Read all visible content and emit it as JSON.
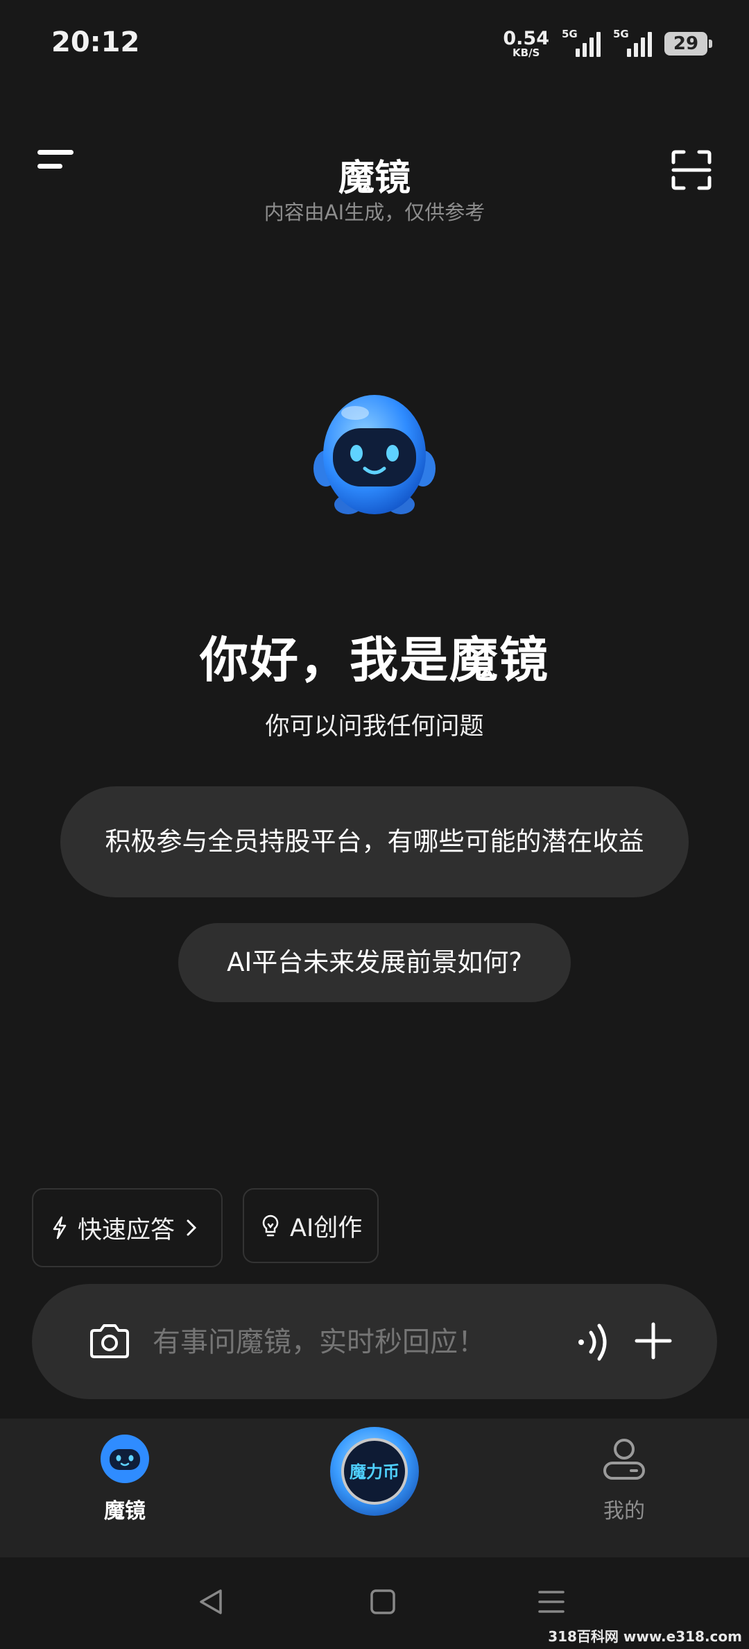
{
  "status_bar": {
    "time": "20:12",
    "net_speed_value": "0.54",
    "net_speed_unit": "KB/S",
    "signal1_label": "5G",
    "signal2_label": "5G",
    "battery": "29"
  },
  "header": {
    "title": "魔镜",
    "subtitle": "内容由AI生成，仅供参考",
    "menu_icon": "menu-icon",
    "scan_icon": "scan-icon"
  },
  "welcome": {
    "mascot_icon": "robot-mascot",
    "greeting": "你好，我是魔镜",
    "prompt": "你可以问我任何问题"
  },
  "suggestions": [
    {
      "text": "积极参与全员持股平台，有哪些可能的潜在收益"
    },
    {
      "text": "AI平台未来发展前景如何?"
    }
  ],
  "modes": {
    "quick": {
      "label": "快速应答",
      "icon": "lightning-icon"
    },
    "create": {
      "label": "AI创作",
      "icon": "lightbulb-icon"
    }
  },
  "input": {
    "placeholder": "有事问魔镜，实时秒回应！",
    "value": ""
  },
  "bottom_nav": {
    "items": [
      {
        "label": "魔镜",
        "icon": "robot-icon",
        "active": true
      },
      {
        "label": "魔力币",
        "icon": "coin-icon",
        "active": false
      },
      {
        "label": "我的",
        "icon": "profile-icon",
        "active": false
      }
    ]
  },
  "colors": {
    "background": "#181818",
    "bubble": "#2f2f2f",
    "accent_blue": "#2f8cff"
  },
  "watermark": "318百科网 www.e318.com"
}
